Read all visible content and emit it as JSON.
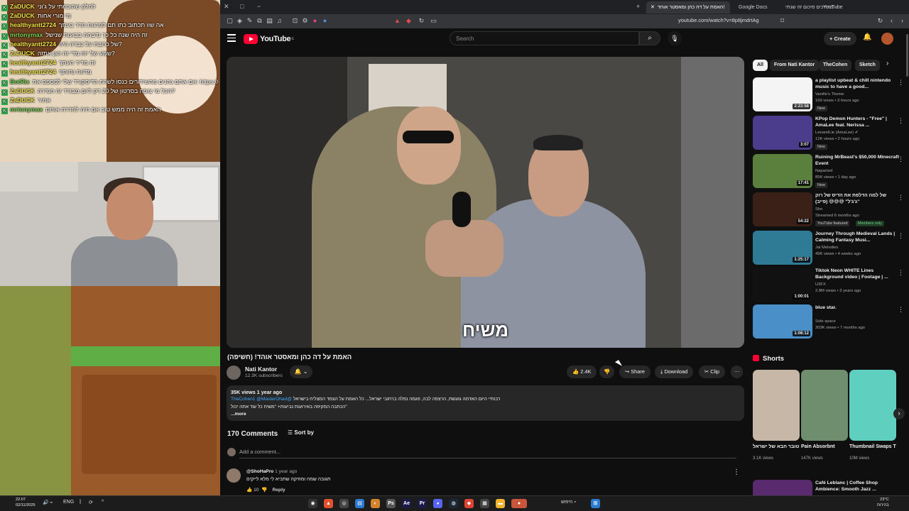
{
  "chat": [
    {
      "user": "ZaDUCK",
      "msg": "לחלק שהוכחתי על ג'וני",
      "green": false
    },
    {
      "user": "ZaDUCK",
      "msg": "מי מורי אחות",
      "green": false
    },
    {
      "user": "healthyantt2724",
      "msg": "אה שוו תכתוב כתו תם לפרגות חדר בעתך",
      "green": false
    },
    {
      "user": "mrtonymax",
      "msg": "זה היה שנה כל כך נדבחה בבועות שנישל",
      "green": true
    },
    {
      "user": "healthyantt2724",
      "msg": "של כתבת על כבדה היה?",
      "green": false
    },
    {
      "user": "ZaDUCK",
      "msg": "שמע של יזה מדי זה הגן אתזה?",
      "green": false
    },
    {
      "user": "healthyantt2724",
      "msg": "זה מדיר העתך",
      "green": false
    },
    {
      "user": "healthyantt2724",
      "msg": "מדווח נחותף",
      "green": false
    },
    {
      "user": "BotRix",
      "msg": "אם אתם נהנים מהשידורים כנסו לשרת הדיסקורד שלי לפספס את: https://discord.gg/a6dD7ghft",
      "green": true
    },
    {
      "user": "ZaDUCK",
      "msg": "הכל מי צופה בסרטון של 20 דק ליום מבודד זה הנדרה?",
      "green": false
    },
    {
      "user": "ZaDUCK",
      "msg": "אתיר",
      "green": false
    },
    {
      "user": "mrtonymax",
      "msg": "האמת זה היה ממש טוב אם חיה לחדרה אותם",
      "green": true
    }
  ],
  "browser": {
    "tabs": [
      "האמת על דה כהן ומאסטר אוהד!",
      "Google Docs",
      "מדריכים סיכום זה שנתי -",
      "YouTube"
    ],
    "url": "youtube.com/watch?v=8p8jmdrtAg"
  },
  "yt": {
    "logo": "YouTube",
    "logo_sup": "IL",
    "search_placeholder": "Search",
    "create": "+ Create"
  },
  "video": {
    "subtitle": "משיח",
    "title": "האמת על דה כהן ומאסטר אוהד! (חשיפה)",
    "channel": "Nati Kantor",
    "subs": "12.3K subscribers",
    "likes": "2.4K",
    "share": "Share",
    "download": "Download",
    "clip": "Clip",
    "views_date": "35K views  1 year ago",
    "desc_line1": "רבותיי היום האדמה גועשת, הרצפה לבה, פגמה נפלה ברחובי ישראל... כל האמת על הצמד המצליח בישראל",
    "desc_links": "@TheCohen1 @MasterOhad",
    "desc_line2": "הכתבה המקיפה באירועות נביעות+ \"משיח כל עוד אתה יכול\"",
    "more": "...more"
  },
  "comments": {
    "count": "170 Comments",
    "sort": "Sort by",
    "add": "Add a comment...",
    "first_user": "@ShoHaPro",
    "first_date": "1 year ago",
    "first_text": "תגובה שמה ומוזיקה שתביא לי מלא לייקים",
    "first_likes": "10",
    "reply": "Reply"
  },
  "chips": [
    "All",
    "From Nati Kantor",
    "TheCohen",
    "Sketch"
  ],
  "recs": [
    {
      "title": "a playlist upbeat & chill nintendo music to have a good...",
      "channel": "Vanille's Theme",
      "meta": "169 views • 3 hours ago",
      "dur": "2:23:58",
      "badge": "New",
      "color": "#f4f4f4"
    },
    {
      "title": "KPop Demon Hunters - \"Free\" | AmaLee feat. Nerissa ...",
      "channel": "LeeandLie (AmaLee) ✔",
      "meta": "12K views • 2 hours ago",
      "dur": "3:07",
      "badge": "New",
      "color": "#4b3c8c"
    },
    {
      "title": "Ruining MrBeast's $50,000 Minecraft Event",
      "channel": "Naparizel",
      "meta": "85K views • 1 day ago",
      "dur": "17:41",
      "badge": "New",
      "color": "#5b7f3c"
    },
    {
      "title": "של למה הדלפת את הדיס של רוק \"ג'ג'ל\" 😅😅😅 (פייב)",
      "channel": "Sho",
      "meta": "Streamed 6 months ago",
      "dur": "54:22",
      "badge": "YouTube featured",
      "badge2": "Members only",
      "color": "#3a2016"
    },
    {
      "title": "Journey Through Medieval Lands | Calming Fantasy Musi...",
      "channel": "Jal Melodies",
      "meta": "49K views • 4 weeks ago",
      "dur": "1:25:17",
      "badge": "",
      "color": "#2f7a95"
    },
    {
      "title": "Tiktok Neon WHITE Lines Background video | Footage | ...",
      "channel": "U3FX",
      "meta": "2.8M views • 3 years ago",
      "dur": "1:00:01",
      "badge": "",
      "color": "#111"
    },
    {
      "title": "blue star.",
      "channel": "Sole space",
      "meta": "303K views • 7 months ago",
      "dur": "1:08:12",
      "badge": "",
      "color": "#4a8fc7"
    }
  ],
  "shorts": {
    "heading": "Shorts",
    "items": [
      {
        "title": "היוטובר הבא של ישראל...",
        "views": "3.1K views",
        "color": "#c7b7a6"
      },
      {
        "title": "Pain Absorbnt",
        "views": "147K views",
        "color": "#6f8e6d"
      },
      {
        "title": "Thumbnail Swaps That...",
        "views": "10M views",
        "color": "#5fd0c0"
      }
    ]
  },
  "rec_last": {
    "title": "Café Leblanc | Coffee Shop Ambience: Smooth Jazz ...",
    "dur": ""
  },
  "taskbar": {
    "time": "22:07",
    "date": "02/11/2025",
    "lang": "ENG",
    "search": "חיפוש",
    "temp": "23°C",
    "weather": "בהירות"
  }
}
